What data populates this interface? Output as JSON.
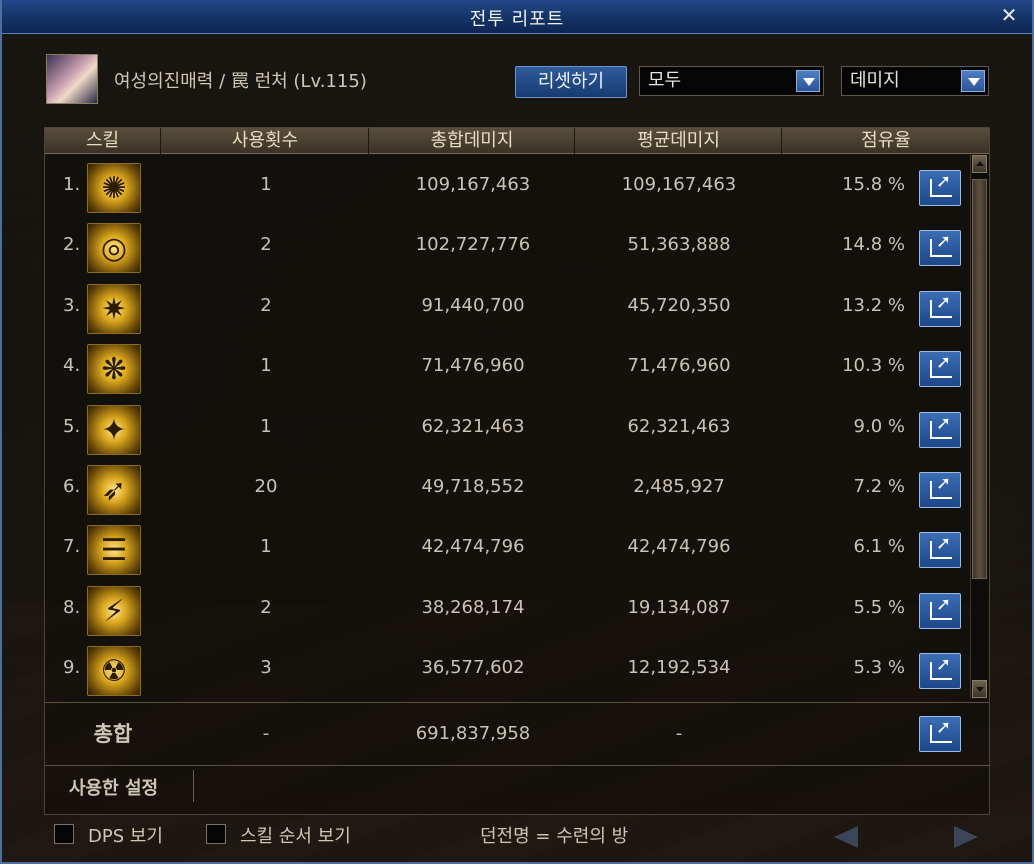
{
  "window": {
    "title": "전투 리포트"
  },
  "character": {
    "name_text": "여성의진매력 / 罠 런처 (Lv.115)"
  },
  "controls": {
    "reset_label": "리셋하기",
    "filter_value": "모두",
    "metric_value": "데미지"
  },
  "table": {
    "headers": {
      "skill": "스킬",
      "uses": "사용횟수",
      "total": "총합데미지",
      "average": "평균데미지",
      "share": "점유율"
    },
    "rows": [
      {
        "index": "1.",
        "icon": "skill-icon-ornament",
        "uses": "1",
        "total": "109,167,463",
        "average": "109,167,463",
        "share": "15.8 %"
      },
      {
        "index": "2.",
        "icon": "skill-icon-rings",
        "uses": "2",
        "total": "102,727,776",
        "average": "51,363,888",
        "share": "14.8 %"
      },
      {
        "index": "3.",
        "icon": "skill-icon-burst",
        "uses": "2",
        "total": "91,440,700",
        "average": "45,720,350",
        "share": "13.2 %"
      },
      {
        "index": "4.",
        "icon": "skill-icon-swirl",
        "uses": "1",
        "total": "71,476,960",
        "average": "71,476,960",
        "share": "10.3 %"
      },
      {
        "index": "5.",
        "icon": "skill-icon-cannons",
        "uses": "1",
        "total": "62,321,463",
        "average": "62,321,463",
        "share": "9.0 %"
      },
      {
        "index": "6.",
        "icon": "skill-icon-launcher",
        "uses": "20",
        "total": "49,718,552",
        "average": "2,485,927",
        "share": "7.2 %"
      },
      {
        "index": "7.",
        "icon": "skill-icon-gatling",
        "uses": "1",
        "total": "42,474,796",
        "average": "42,474,796",
        "share": "6.1 %"
      },
      {
        "index": "8.",
        "icon": "skill-icon-laser",
        "uses": "2",
        "total": "38,268,174",
        "average": "19,134,087",
        "share": "5.5 %"
      },
      {
        "index": "9.",
        "icon": "skill-icon-radiation",
        "uses": "3",
        "total": "36,577,602",
        "average": "12,192,534",
        "share": "5.3 %"
      }
    ],
    "total": {
      "label": "총합",
      "uses": "-",
      "total": "691,837,958",
      "average": "-"
    },
    "settings_label": "사용한 설정"
  },
  "footer": {
    "dps_label": "DPS 보기",
    "order_label": "스킬 순서 보기",
    "dungeon_text": "던전명 = 수련의 방"
  }
}
